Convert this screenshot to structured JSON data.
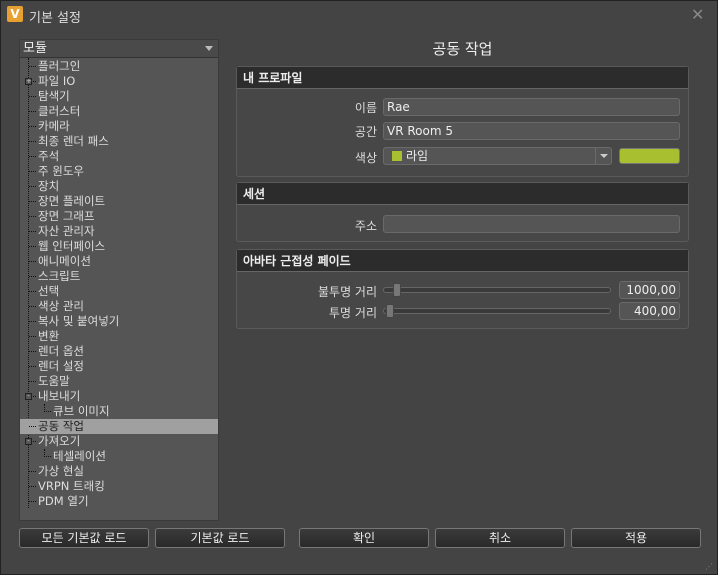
{
  "window": {
    "title": "기본 설정",
    "logo": "V"
  },
  "tree": {
    "header": "모듈",
    "items": [
      {
        "label": "플러그인"
      },
      {
        "label": "파일 IO",
        "expander": "+"
      },
      {
        "label": "탐색기"
      },
      {
        "label": "클러스터"
      },
      {
        "label": "카메라"
      },
      {
        "label": "최종 렌더 패스"
      },
      {
        "label": "주석"
      },
      {
        "label": "주 윈도우"
      },
      {
        "label": "장치"
      },
      {
        "label": "장면 플레이트"
      },
      {
        "label": "장면 그래프"
      },
      {
        "label": "자산 관리자"
      },
      {
        "label": "웹 인터페이스"
      },
      {
        "label": "애니메이션"
      },
      {
        "label": "스크립트"
      },
      {
        "label": "선택"
      },
      {
        "label": "색상 관리"
      },
      {
        "label": "복사 및 붙여넣기"
      },
      {
        "label": "변환"
      },
      {
        "label": "렌더 옵션"
      },
      {
        "label": "렌더 설정"
      },
      {
        "label": "도움말"
      },
      {
        "label": "내보내기",
        "expander": "-"
      },
      {
        "label": "큐브 이미지",
        "child": true
      },
      {
        "label": "공동 작업",
        "selected": true
      },
      {
        "label": "가져오기",
        "expander": "-"
      },
      {
        "label": "테셀레이션",
        "child": true
      },
      {
        "label": "가상 현실"
      },
      {
        "label": "VRPN 트래킹"
      },
      {
        "label": "PDM 열기"
      }
    ]
  },
  "page": {
    "title": "공동 작업"
  },
  "profile": {
    "header": "내 프로파일",
    "name_label": "이름",
    "name_value": "Rae",
    "room_label": "공간",
    "room_value": "VR Room 5",
    "color_label": "색상",
    "color_value": "라임",
    "color_hex": "#a8c030"
  },
  "session": {
    "header": "세션",
    "address_label": "주소",
    "address_value": ""
  },
  "fade": {
    "header": "아바타 근접성 페이드",
    "opaque_label": "불투명 거리",
    "opaque_value": "1000,00",
    "transparent_label": "투명 거리",
    "transparent_value": "400,00"
  },
  "buttons": {
    "load_all_defaults": "모든 기본값 로드",
    "load_defaults": "기본값 로드",
    "ok": "확인",
    "cancel": "취소",
    "apply": "적용"
  }
}
